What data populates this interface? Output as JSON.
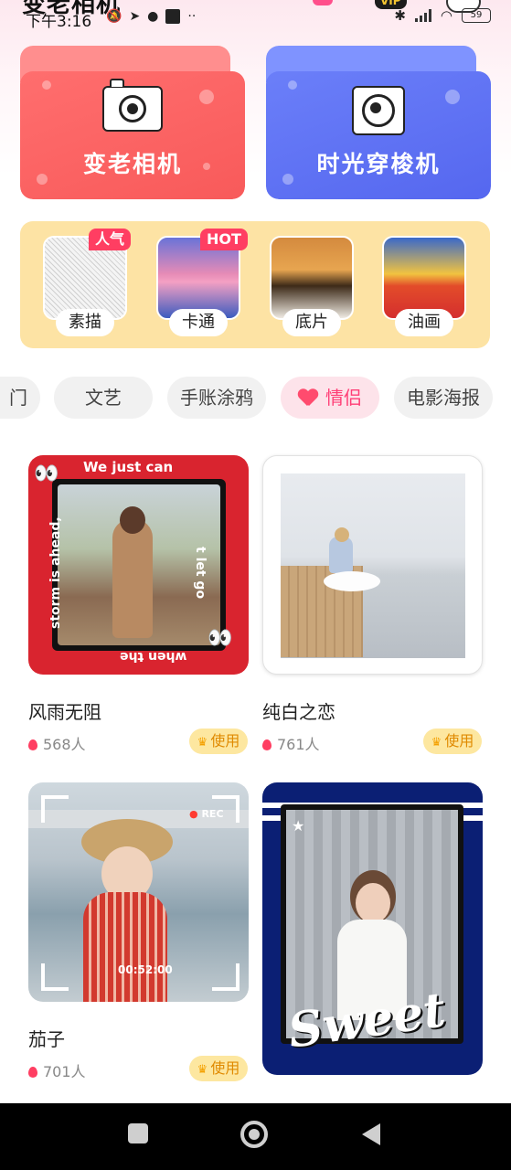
{
  "status_bar": {
    "app_title": "变老相机",
    "time": "下午3:16",
    "vip_label": "VIP",
    "battery": "59"
  },
  "hero": {
    "aging_camera_label": "变老相机",
    "time_machine_label": "时光穿梭机"
  },
  "styles": [
    {
      "label": "素描",
      "badge": "人气"
    },
    {
      "label": "卡通",
      "badge": "HOT"
    },
    {
      "label": "底片",
      "badge": ""
    },
    {
      "label": "油画",
      "badge": ""
    }
  ],
  "categories": [
    {
      "label": "门",
      "active": false
    },
    {
      "label": "文艺",
      "active": false
    },
    {
      "label": "手账涂鸦",
      "active": false
    },
    {
      "label": "情侣",
      "active": true
    },
    {
      "label": "电影海报",
      "active": false
    }
  ],
  "templates": [
    {
      "name": "风雨无阻",
      "count": "568人",
      "use": "使用",
      "frame_text_top": "We just can",
      "frame_text_right": "t let go",
      "frame_text_bottom": "when the",
      "frame_text_left": "storm is ahead,"
    },
    {
      "name": "纯白之恋",
      "count": "761人",
      "use": "使用"
    },
    {
      "name": "茄子",
      "count": "701人",
      "use": "使用",
      "overlay_rec": "REC",
      "overlay_time": "00:52:00"
    },
    {
      "name": "",
      "count": "",
      "use": "",
      "overlay_word": "Sweet"
    }
  ],
  "colors": {
    "accent_pink": "#ff3e76",
    "aging_card": "#f85a5a",
    "time_card": "#5567ef",
    "style_strip_bg": "#fde3a4",
    "use_button_bg": "#fde7a0"
  }
}
